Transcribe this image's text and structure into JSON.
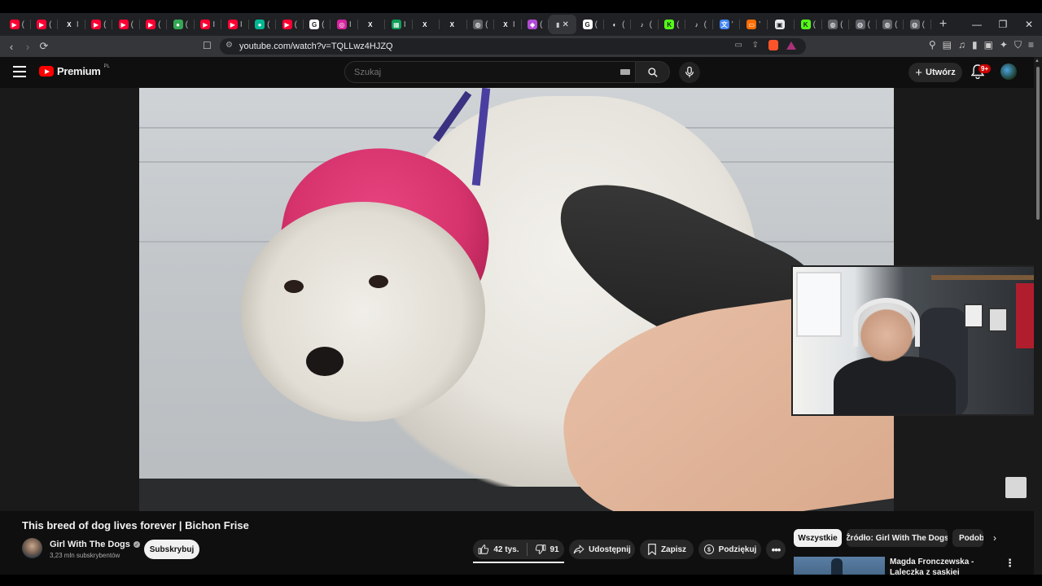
{
  "browser": {
    "url": "youtube.com/watch?v=TQLLwz4HJZQ",
    "tabs": [
      {
        "icon": "youtube-icon",
        "label": "(",
        "color": "#ff0033",
        "glyph": "▶"
      },
      {
        "icon": "youtube-icon",
        "label": "(",
        "color": "#ff0033",
        "glyph": "▶"
      },
      {
        "icon": "x-icon",
        "label": "I",
        "color": "#202124",
        "glyph": "X"
      },
      {
        "icon": "youtube-icon",
        "label": "(",
        "color": "#ff0033",
        "glyph": "▶"
      },
      {
        "icon": "youtube-icon",
        "label": "(",
        "color": "#ff0033",
        "glyph": "▶"
      },
      {
        "icon": "youtube-icon",
        "label": "(",
        "color": "#ff0033",
        "glyph": "▶"
      },
      {
        "icon": "maps-icon",
        "label": "(",
        "color": "#34a853",
        "glyph": "●"
      },
      {
        "icon": "youtube-icon",
        "label": "I",
        "color": "#ff0033",
        "glyph": "▶"
      },
      {
        "icon": "youtube-icon",
        "label": "I",
        "color": "#ff0033",
        "glyph": "▶"
      },
      {
        "icon": "app-icon",
        "label": "(",
        "color": "#00b894",
        "glyph": "●"
      },
      {
        "icon": "youtube-icon",
        "label": "(",
        "color": "#ff0033",
        "glyph": "▶"
      },
      {
        "icon": "google-icon",
        "label": "(",
        "color": "#ffffff",
        "glyph": "G"
      },
      {
        "icon": "instagram-icon",
        "label": "I",
        "color": "#d6249f",
        "glyph": "◎"
      },
      {
        "icon": "x-icon",
        "label": "",
        "color": "#202124",
        "glyph": "X"
      },
      {
        "icon": "sheets-icon",
        "label": "I",
        "color": "#0f9d58",
        "glyph": "▦"
      },
      {
        "icon": "x-icon",
        "label": "",
        "color": "#202124",
        "glyph": "X"
      },
      {
        "icon": "x-icon",
        "label": "",
        "color": "#202124",
        "glyph": "X"
      },
      {
        "icon": "globe-icon",
        "label": "(",
        "color": "#5f6368",
        "glyph": "◍"
      },
      {
        "icon": "x-icon",
        "label": "I",
        "color": "#202124",
        "glyph": "X"
      },
      {
        "icon": "app-icon",
        "label": "(",
        "color": "#b44ad6",
        "glyph": "◆"
      }
    ],
    "tabs_after": [
      {
        "icon": "google-icon",
        "label": "(",
        "color": "#ffffff",
        "glyph": "G"
      },
      {
        "icon": "github-icon",
        "label": "(",
        "color": "#202124",
        "glyph": "◐"
      },
      {
        "icon": "tiktok-icon",
        "label": "(",
        "color": "#202124",
        "glyph": "♪"
      },
      {
        "icon": "kick-icon",
        "label": "(",
        "color": "#53fc18",
        "glyph": "K"
      },
      {
        "icon": "tiktok-icon",
        "label": "(",
        "color": "#202124",
        "glyph": "♪"
      },
      {
        "icon": "translate-icon",
        "label": "'",
        "color": "#4285f4",
        "glyph": "文"
      },
      {
        "icon": "app-icon",
        "label": "'",
        "color": "#ff6d00",
        "glyph": "▭"
      },
      {
        "icon": "app-icon",
        "label": "",
        "color": "#e8eaed",
        "glyph": "▣"
      },
      {
        "icon": "kick-icon",
        "label": "(",
        "color": "#53fc18",
        "glyph": "K"
      },
      {
        "icon": "globe-icon",
        "label": "(",
        "color": "#5f6368",
        "glyph": "◍"
      },
      {
        "icon": "globe-icon",
        "label": "(",
        "color": "#5f6368",
        "glyph": "◍"
      },
      {
        "icon": "globe-icon",
        "label": "(",
        "color": "#5f6368",
        "glyph": "◍"
      },
      {
        "icon": "globe-icon",
        "label": "(",
        "color": "#5f6368",
        "glyph": "◍"
      }
    ]
  },
  "youtube": {
    "logo_text": "Premium",
    "logo_region": "PL",
    "search_placeholder": "Szukaj",
    "create_label": "Utwórz",
    "notifications_badge": "9+"
  },
  "video": {
    "title": "This breed of dog lives forever | Bichon Frise",
    "channel_name": "Girl With The Dogs",
    "subscribers": "3,23 mln subskrybentów",
    "subscribe_label": "Subskrybuj",
    "likes": "42 tys.",
    "dislikes": "91",
    "share_label": "Udostępnij",
    "save_label": "Zapisz",
    "thanks_label": "Podziękuj"
  },
  "chips": [
    "Wszystkie",
    "Źródło: Girl With The Dogs",
    "Podobne"
  ],
  "recommendation": {
    "title": "Magda Fronczewska - Laleczka z saskiej porcelany (cover by..."
  },
  "colors": {
    "accent": "#ff0000",
    "background": "#0f0f0f",
    "pill": "#272727"
  }
}
